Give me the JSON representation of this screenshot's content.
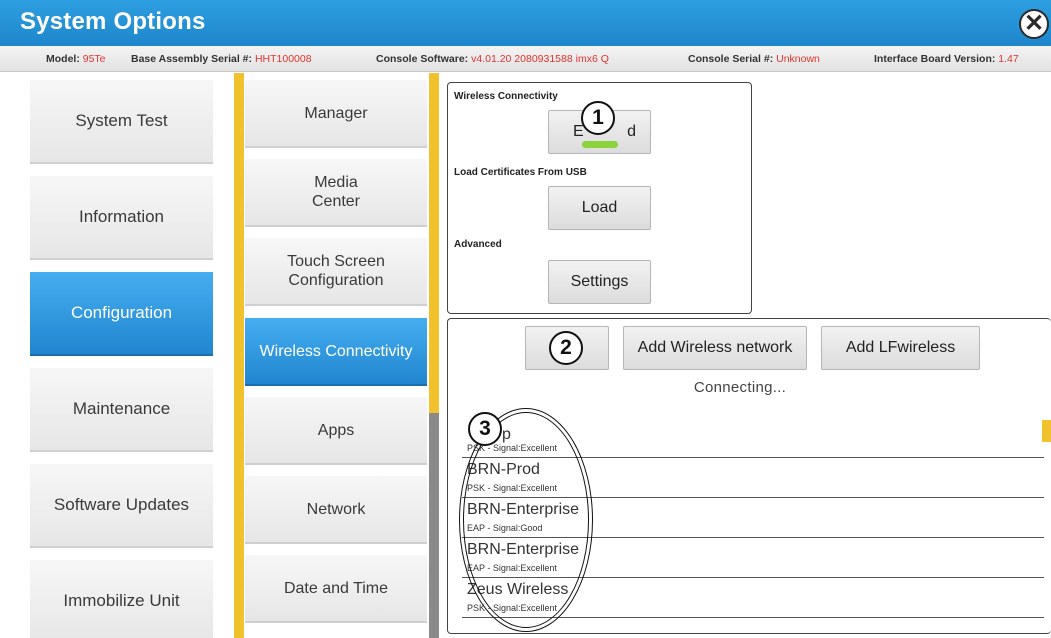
{
  "window": {
    "title": "System Options",
    "close_glyph": "✕"
  },
  "info": [
    {
      "label": "Model:",
      "value": "95Te"
    },
    {
      "label": "Base Assembly Serial #:",
      "value": "HHT100008"
    },
    {
      "label": "Console Software:",
      "value": "v4.01.20 2080931588 imx6 Q"
    },
    {
      "label": "Console Serial #:",
      "value": "Unknown"
    },
    {
      "label": "Interface Board Version:",
      "value": "1.47"
    }
  ],
  "left_menu": [
    {
      "label": "System Test"
    },
    {
      "label": "Information"
    },
    {
      "label": "Configuration",
      "active": true
    },
    {
      "label": "Maintenance"
    },
    {
      "label": "Software Updates"
    },
    {
      "label": "Immobilize Unit"
    }
  ],
  "sub_menu": [
    {
      "label": "Manager"
    },
    {
      "label": "Media\nCenter"
    },
    {
      "label": "Touch Screen\nConfiguration"
    },
    {
      "label": "Wireless Connectivity",
      "active": true
    },
    {
      "label": "Apps"
    },
    {
      "label": "Network"
    },
    {
      "label": "Date and Time"
    }
  ],
  "panel": {
    "wireless_label": "Wireless Connectivity",
    "wireless_button": "Enabled",
    "wireless_button_visible_left": "E",
    "wireless_button_visible_right": "d",
    "cert_label": "Load Certificates From USB",
    "load_button": "Load",
    "advanced_label": "Advanced",
    "settings_button": "Settings"
  },
  "networks_panel": {
    "add_wireless": "Add Wireless network",
    "add_lf": "Add LFwireless",
    "status": "Connecting...",
    "first_row_visible_name": "p",
    "first_row_visible_detail": "PSK - Signal:Excellent",
    "networks": [
      {
        "name": "BRN-Prod",
        "detail": "PSK - Signal:Excellent"
      },
      {
        "name": "BRN-Enterprise",
        "detail": "EAP - Signal:Good"
      },
      {
        "name": "BRN-Enterprise",
        "detail": "EAP - Signal:Excellent"
      },
      {
        "name": "Zeus Wireless",
        "detail": "PSK - Signal:Excellent"
      }
    ]
  },
  "callouts": [
    "1",
    "2",
    "3"
  ],
  "colors": {
    "accent_blue": "#2186cf",
    "value_red": "#e0342d",
    "menu_yellow": "#f2c22e",
    "led_green": "#8cd23c"
  }
}
